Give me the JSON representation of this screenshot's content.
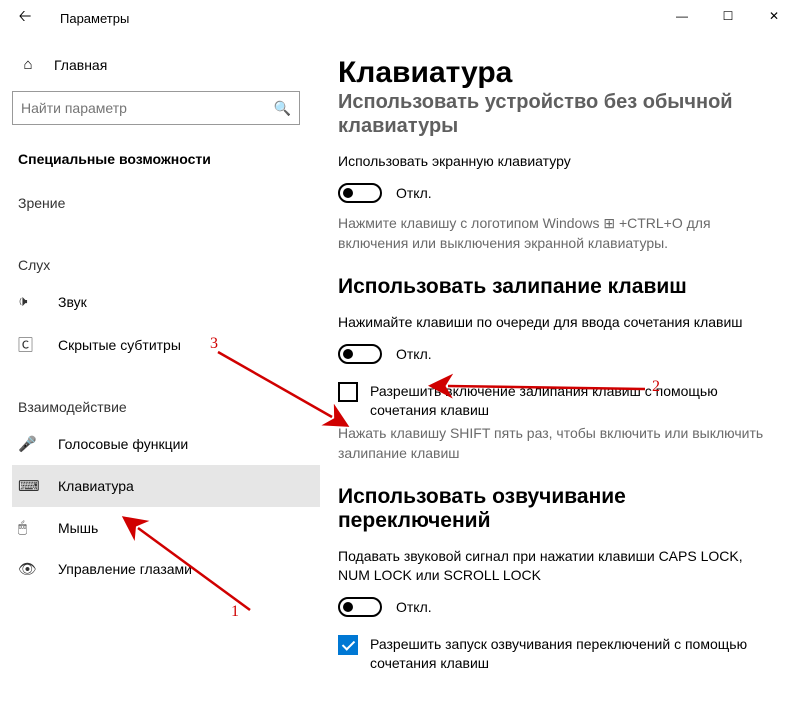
{
  "window": {
    "title": "Параметры"
  },
  "sidebar": {
    "home": "Главная",
    "search_placeholder": "Найти параметр",
    "group_main": "Специальные возможности",
    "group_vision": "Зрение",
    "group_hearing": "Слух",
    "group_interaction": "Взаимодействие",
    "items_hearing": [
      {
        "icon": "🕩",
        "label": "Звук"
      },
      {
        "icon": "🄲",
        "label": "Скрытые субтитры"
      }
    ],
    "items_interaction": [
      {
        "icon": "🎤",
        "label": "Голосовые функции"
      },
      {
        "icon": "⌨",
        "label": "Клавиатура",
        "selected": true
      },
      {
        "icon": "🖱",
        "label": "Мышь"
      },
      {
        "icon": "👁",
        "label": "Управление глазами"
      }
    ]
  },
  "content": {
    "page_title": "Клавиатура",
    "section1_title_partial": "Использовать устройство без обычной клавиатуры",
    "section1_desc": "Использовать экранную клавиатуру",
    "section1_toggle": "Откл.",
    "section1_hint": "Нажмите клавишу с логотипом Windows ⊞ +CTRL+O для включения или выключения экранной клавиатуры.",
    "section2_title": "Использовать залипание клавиш",
    "section2_desc": "Нажимайте клавиши по очереди для ввода сочетания клавиш",
    "section2_toggle": "Откл.",
    "section2_check": "Разрешить включение залипания клавиш с помощью сочетания клавиш",
    "section2_hint": "Нажать клавишу SHIFT пять раз, чтобы включить или выключить залипание клавиш",
    "section3_title": "Использовать озвучивание переключений",
    "section3_desc": "Подавать звуковой сигнал при нажатии клавиши CAPS LOCK, NUM LOCK или SCROLL LOCK",
    "section3_toggle": "Откл.",
    "section3_check": "Разрешить запуск озвучивания переключений с помощью сочетания клавиш"
  },
  "annotations": {
    "n1": "1",
    "n2": "2",
    "n3": "3"
  }
}
